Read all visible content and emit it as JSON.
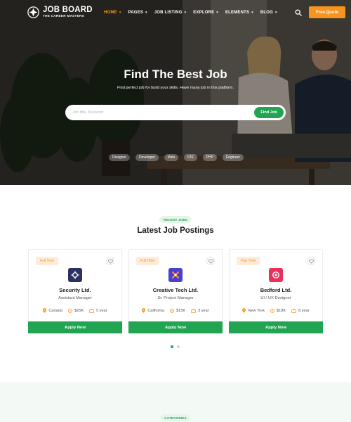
{
  "nav": {
    "logo_title": "JOB BOARD",
    "logo_sub": "THE CAREER MASTERS",
    "menu": [
      {
        "label": "HOME",
        "active": true
      },
      {
        "label": "PAGES",
        "active": false
      },
      {
        "label": "JOB LISTING",
        "active": false
      },
      {
        "label": "EXPLORE",
        "active": false
      },
      {
        "label": "ELEMENTS",
        "active": false
      },
      {
        "label": "BLOG",
        "active": false
      }
    ],
    "quote_label": "Free Quote"
  },
  "hero": {
    "title": "Find The Best Job",
    "subtitle": "Find perfect job for build your skills. Have many job in this platform.",
    "search_placeholder": "Job title, Keyword",
    "find_label": "Find Job",
    "tags": [
      "Designer",
      "Developer",
      "Web",
      "IOS",
      "PHP",
      "Engineer"
    ]
  },
  "recent": {
    "badge": "RECENT JOBS",
    "title": "Latest Job Postings",
    "cards": [
      {
        "type": "Full Time",
        "company": "Security Ltd.",
        "position": "Assistant Manager",
        "location": "Canada",
        "salary": "$25K",
        "experience": "5 year",
        "logo_color": "#2b3160",
        "logo_icon": "gear-icon"
      },
      {
        "type": "Full Time",
        "company": "Creative Tech Ltd.",
        "position": "Sr. Project Manager",
        "location": "California",
        "salary": "$15K",
        "experience": "3 year",
        "logo_color": "#4a3fd1",
        "logo_icon": "compass-icon"
      },
      {
        "type": "Part Time",
        "company": "Bedford Ltd.",
        "position": "UI / UX Designer",
        "location": "New York",
        "salary": "$18K",
        "experience": "8 year",
        "logo_color": "#e8315a",
        "logo_icon": "flower-icon"
      }
    ],
    "apply_label": "Apply Now",
    "slides": 2,
    "active_slide": 1
  },
  "categories": {
    "badge": "CATEGORIES"
  },
  "colors": {
    "accent_orange": "#f7941d",
    "accent_green": "#22a553"
  }
}
